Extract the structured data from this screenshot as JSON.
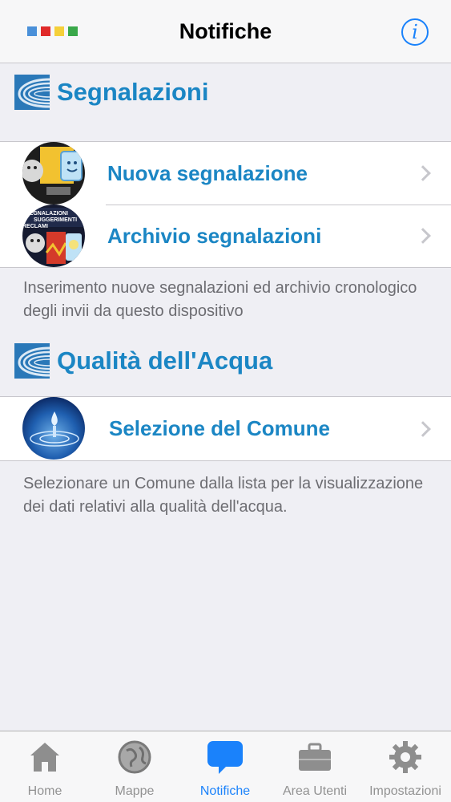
{
  "navbar": {
    "title": "Notifiche",
    "info_icon": "info-icon",
    "dot_colors": [
      "#4a90d9",
      "#e02a2a",
      "#f5d03a",
      "#3aa84a"
    ]
  },
  "sections": [
    {
      "title": "Segnalazioni",
      "logo_icon": "arpa-logo-icon",
      "rows": [
        {
          "label": "Nuova segnalazione",
          "icon": "new-report-icon"
        },
        {
          "label": "Archivio segnalazioni",
          "icon": "report-archive-icon",
          "icon_text": "SEGNALAZIONI SUGGERIMENTI RECLAMI"
        }
      ],
      "footer": "Inserimento nuove segnalazioni ed archivio cronologico degli invii da questo dispositivo"
    },
    {
      "title": "Qualità dell'Acqua",
      "logo_icon": "arpa-logo-icon",
      "rows": [
        {
          "label": "Selezione del Comune",
          "icon": "water-drop-icon"
        }
      ],
      "footer": "Selezionare un Comune dalla lista per la visualizzazione dei dati relativi alla qualità dell'acqua."
    }
  ],
  "tabbar": {
    "items": [
      {
        "label": "Home",
        "icon": "home-icon",
        "active": false
      },
      {
        "label": "Mappe",
        "icon": "globe-icon",
        "active": false
      },
      {
        "label": "Notifiche",
        "icon": "speech-bubble-icon",
        "active": true
      },
      {
        "label": "Area Utenti",
        "icon": "briefcase-icon",
        "active": false
      },
      {
        "label": "Impostazioni",
        "icon": "gear-icon",
        "active": false
      }
    ]
  },
  "colors": {
    "accent": "#1b86c4",
    "tab_active": "#1a82fb",
    "tab_inactive": "#929292"
  }
}
